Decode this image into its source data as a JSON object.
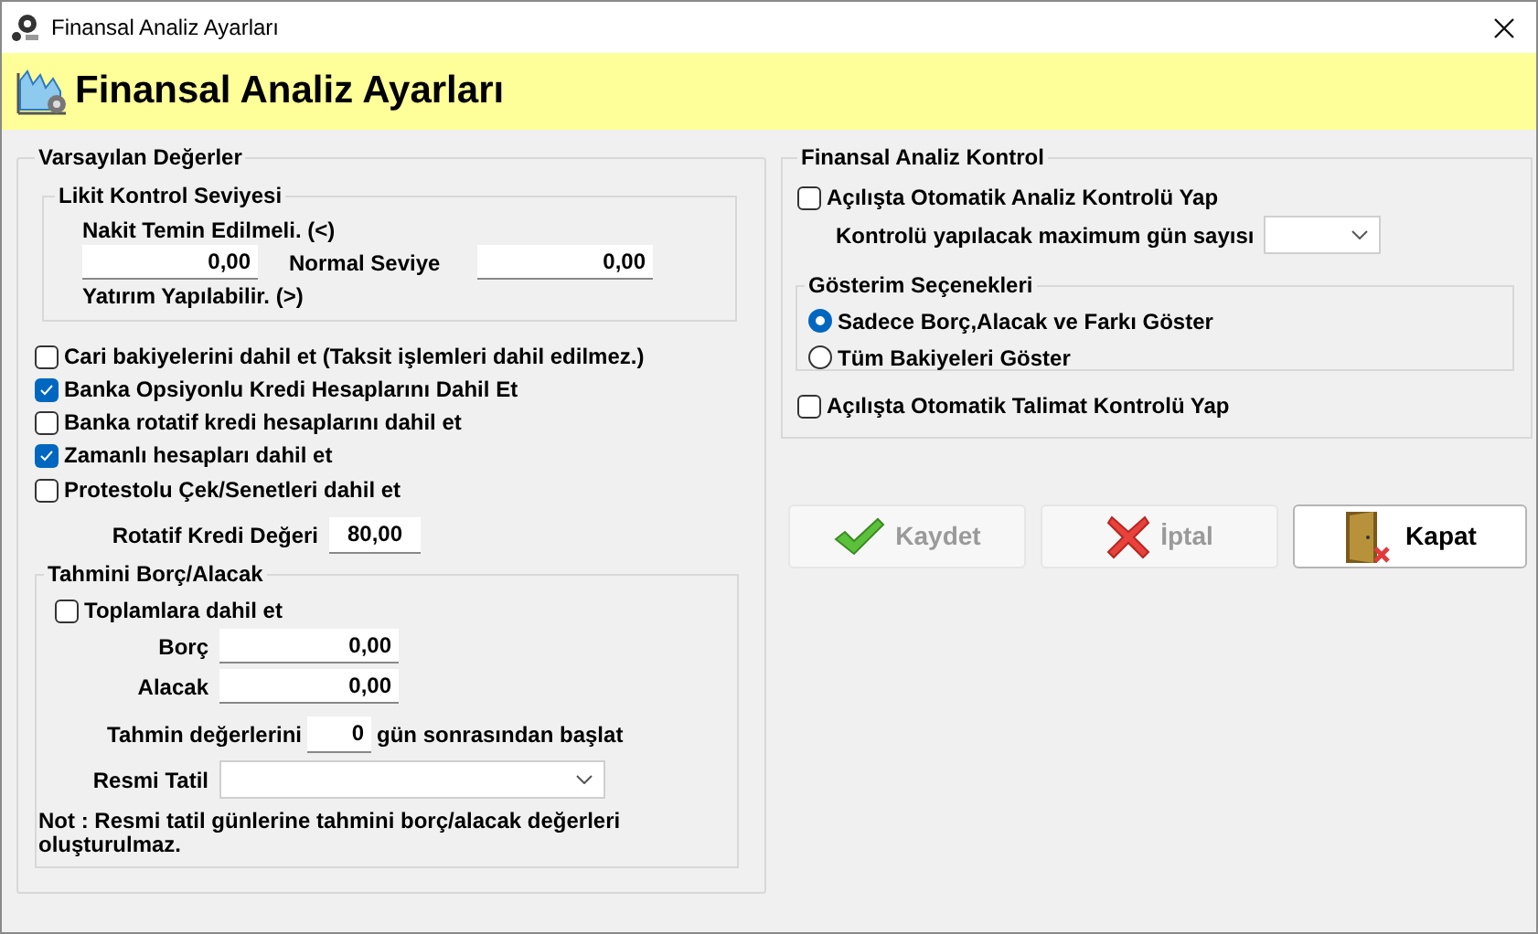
{
  "window": {
    "title": "Finansal Analiz Ayarları"
  },
  "header": {
    "title": "Finansal Analiz Ayarları"
  },
  "defaults": {
    "title": "Varsayılan Değerler",
    "liquidity": {
      "title": "Likit Kontrol Seviyesi",
      "cash_label": "Nakit Temin Edilmeli. (<)",
      "cash_value": "0,00",
      "normal_label": "Normal Seviye",
      "normal_value": "0,00",
      "invest_label": "Yatırım Yapılabilir. (>)"
    },
    "options": [
      {
        "label": "Cari bakiyelerini dahil et (Taksit işlemleri dahil edilmez.)",
        "checked": false
      },
      {
        "label": "Banka Opsiyonlu Kredi Hesaplarını Dahil Et",
        "checked": true
      },
      {
        "label": "Banka rotatif kredi hesaplarını dahil et",
        "checked": false
      },
      {
        "label": "Zamanlı hesapları dahil et",
        "checked": true
      },
      {
        "label": "Protestolu Çek/Senetleri dahil et",
        "checked": false
      }
    ],
    "revolving": {
      "label": "Rotatif Kredi Değeri",
      "value": "80,00"
    },
    "estimate": {
      "title": "Tahmini Borç/Alacak",
      "include": {
        "label": "Toplamlara dahil et",
        "checked": false
      },
      "fields": [
        {
          "label": "Borç",
          "value": "0,00"
        },
        {
          "label": "Alacak",
          "value": "0,00"
        }
      ],
      "start_label": "Tahmin değerlerini",
      "start_value": "0",
      "start_suffix": "gün sonrasından başlat",
      "holiday_label": "Resmi Tatil",
      "note": "Not : Resmi tatil günlerine tahmini borç/alacak değerleri oluşturulmaz."
    }
  },
  "control": {
    "title": "Finansal Analiz Kontrol",
    "auto_analysis": {
      "label": "Açılışta Otomatik Analiz Kontrolü Yap",
      "checked": false
    },
    "max_days_label": "Kontrolü yapılacak maximum gün sayısı",
    "display": {
      "title": "Gösterim Seçenekleri",
      "options": [
        {
          "label": "Sadece Borç,Alacak ve Farkı Göster",
          "selected": true
        },
        {
          "label": "Tüm Bakiyeleri Göster",
          "selected": false
        }
      ]
    },
    "auto_instruction": {
      "label": "Açılışta Otomatik Talimat Kontrolü Yap",
      "checked": false
    }
  },
  "buttons": [
    {
      "kind": "save",
      "label": "Kaydet",
      "disabled": true
    },
    {
      "kind": "cancel",
      "label": "İptal",
      "disabled": true
    },
    {
      "kind": "close",
      "label": "Kapat",
      "disabled": false
    }
  ]
}
